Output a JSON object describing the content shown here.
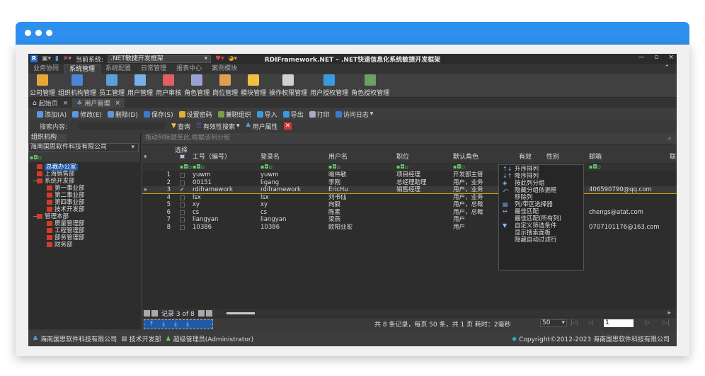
{
  "window": {
    "title": "RDIFramework.NET – .NET快速信息化系统敏捷开发框架",
    "current_system_label": "当前系统:",
    "current_system_value": ".NET敏捷开发框架",
    "min_btn": "—",
    "max_btn": "▫",
    "close_btn": "×"
  },
  "menu": {
    "tabs": [
      {
        "label": "业务协同"
      },
      {
        "label": "系统管理"
      },
      {
        "label": "系统配置"
      },
      {
        "label": "日常管理"
      },
      {
        "label": "报表中心"
      },
      {
        "label": "案例模块"
      }
    ],
    "collapse": "⌃"
  },
  "ribbon": {
    "buttons": [
      {
        "label": "公司管理",
        "color": "#e8a63a"
      },
      {
        "label": "组织机构管理",
        "color": "#4a86d8"
      },
      {
        "label": "员工管理",
        "color": "#5aa0e0"
      },
      {
        "label": "用户管理",
        "color": "#7ab0e8"
      },
      {
        "label": "用户审核",
        "color": "#e06060"
      },
      {
        "label": "角色管理",
        "color": "#9aa0d0"
      },
      {
        "label": "岗位管理",
        "color": "#e0a050"
      },
      {
        "label": "模块管理",
        "color": "#f0c040"
      },
      {
        "label": "操作权限管理",
        "color": "#d0d0d0"
      },
      {
        "label": "用户授权管理",
        "color": "#3a9ae0"
      },
      {
        "label": "角色授权管理",
        "color": "#6aa060"
      }
    ]
  },
  "doc_tabs": [
    {
      "label": "起始页"
    },
    {
      "label": "用户管理"
    }
  ],
  "toolbar": {
    "add": "添加(A)",
    "edit": "修改(E)",
    "delete": "删除(D)",
    "save": "保存(S)",
    "set_password": "设置密码",
    "part_time": "兼职组织",
    "import": "导入",
    "export": "导出",
    "print": "打印",
    "access_log": "访问日志"
  },
  "search": {
    "label": "搜索内容:",
    "query_btn": "查询",
    "validity_search": "有效性搜索",
    "user_attr": "用户属性"
  },
  "left_panel": {
    "tab": "组织机构",
    "org_value": "海南国思软件科技有限公司",
    "filter_icon": "▪◘▫",
    "tree": [
      {
        "label": "总裁办公室",
        "level": 1,
        "expander": ""
      },
      {
        "label": "上海销售部",
        "level": 1,
        "expander": ""
      },
      {
        "label": "系统开发部",
        "level": 1,
        "expander": "−"
      },
      {
        "label": "第一事业部",
        "level": 2,
        "expander": ""
      },
      {
        "label": "第二事业部",
        "level": 2,
        "expander": ""
      },
      {
        "label": "第四事业部",
        "level": 2,
        "expander": ""
      },
      {
        "label": "技术开发部",
        "level": 2,
        "expander": ""
      },
      {
        "label": "管理本部",
        "level": 1,
        "expander": "−"
      },
      {
        "label": "质量管理部",
        "level": 2,
        "expander": ""
      },
      {
        "label": "工程管理部",
        "level": 2,
        "expander": ""
      },
      {
        "label": "部务管理部",
        "level": 2,
        "expander": ""
      },
      {
        "label": "财务部",
        "level": 2,
        "expander": ""
      }
    ]
  },
  "grid": {
    "group_hint": "拖动列标题至此,根据该列分组",
    "select_label": "选择",
    "columns": [
      "工号（编号）",
      "登录名",
      "用户名",
      "职位",
      "默认角色",
      "有效",
      "性别",
      "邮箱",
      "联"
    ],
    "filter_glyph": "▪◘▫",
    "rows": [
      {
        "num": "1",
        "checked": "",
        "id": "yuwm",
        "login": "yuwm",
        "name": "喻伟敏",
        "position": "项目经理",
        "role": "开发部主管",
        "email": ""
      },
      {
        "num": "2",
        "checked": "",
        "id": "00151",
        "login": "ligang",
        "name": "李刚",
        "position": "总经理助理",
        "role": "用户，业务",
        "email": ""
      },
      {
        "num": "3",
        "checked": "✓",
        "id": "rdiframework",
        "login": "rdiframework",
        "name": "EricHu",
        "position": "销售经理",
        "role": "用户，业务",
        "email": "406590790@qq.com"
      },
      {
        "num": "4",
        "checked": "",
        "id": "lsx",
        "login": "lsx",
        "name": "刘书仙",
        "position": "",
        "role": "用户，业务",
        "email": ""
      },
      {
        "num": "5",
        "checked": "",
        "id": "xy",
        "login": "xy",
        "name": "向毅",
        "position": "",
        "role": "用户，总裁",
        "email": ""
      },
      {
        "num": "6",
        "checked": "",
        "id": "cs",
        "login": "cs",
        "name": "陈素",
        "position": "",
        "role": "用户，总裁",
        "email": "chengs@atat.com"
      },
      {
        "num": "7",
        "checked": "",
        "id": "liangyan",
        "login": "liangyan",
        "name": "梁燕",
        "position": "",
        "role": "用户",
        "email": ""
      },
      {
        "num": "8",
        "checked": "",
        "id": "10386",
        "login": "10386",
        "name": "欧阳业宏",
        "position": "",
        "role": "用户",
        "email": "0707101176@163.com"
      }
    ],
    "record_nav": "记录 3 of 8",
    "pager_summary": "共 8 条记录，每页 50 条，共 1 页 耗时：2毫秒",
    "page_size": "50",
    "page_input": "1",
    "current_row_marker": "▸",
    "header_row_marker": "▾"
  },
  "context_menu": {
    "items": [
      {
        "label": "升序排列",
        "icon": "↑↓"
      },
      {
        "label": "降序排列",
        "icon": "↓↑"
      },
      {
        "label": "按此列分组",
        "icon": "◈"
      },
      {
        "label": "隐藏分组依据框",
        "icon": "⤺"
      },
      {
        "label": "移除列",
        "icon": ""
      },
      {
        "label": "列/带区选择器",
        "icon": "▤"
      },
      {
        "label": "最佳匹配",
        "icon": "↔"
      },
      {
        "label": "最佳匹配(所有列)",
        "icon": ""
      },
      {
        "label": "自定义筛选条件",
        "icon": "▼"
      },
      {
        "label": "显示搜索面板",
        "icon": ""
      },
      {
        "label": "隐藏自动过滤行",
        "icon": ""
      }
    ]
  },
  "status": {
    "company": "海南国思软件科技有限公司",
    "dept": "技术开发部",
    "user": "超级管理员(Administrator)",
    "copyright": "Copyright©2012-2023 海南国思软件科技有限公司"
  },
  "colors": {
    "browser_bar": "#2e90ee",
    "selection": "#1f5aa6",
    "current_row_line": "#d6a400"
  }
}
